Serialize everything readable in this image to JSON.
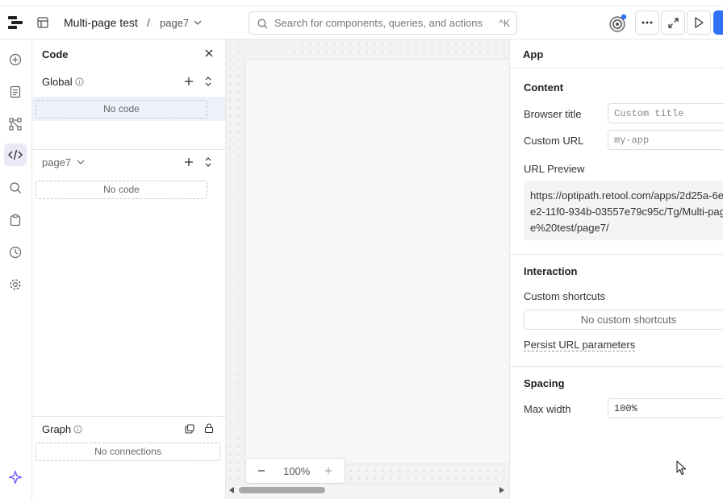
{
  "header": {
    "app_name": "Multi-page test",
    "separator": "/",
    "page_name": "page7",
    "search": {
      "placeholder": "Search for components, queries, and actions",
      "shortcut": "^K"
    }
  },
  "left_rail": {
    "icons": [
      "add-icon",
      "pages-icon",
      "components-tree-icon",
      "code-icon",
      "search-icon",
      "state-icon",
      "history-icon",
      "settings-icon",
      "assist-sparkle-icon"
    ],
    "active": "code-icon"
  },
  "code_panel": {
    "title": "Code",
    "global": {
      "label": "Global",
      "empty": "No code"
    },
    "page": {
      "label": "page7",
      "empty": "No code"
    },
    "graph": {
      "label": "Graph",
      "empty": "No connections"
    }
  },
  "canvas": {
    "zoom": "100%"
  },
  "inspector": {
    "title": "App",
    "content": {
      "heading": "Content",
      "browser_title": {
        "label": "Browser title",
        "placeholder": "Custom title"
      },
      "custom_url": {
        "label": "Custom URL",
        "placeholder": "my-app"
      },
      "url_preview": {
        "label": "URL Preview",
        "value": "https://optipath.retool.com/apps/2d25a-6ee2-11f0-934b-03557e79c95c/Tg/Multi-page%20test/page7/"
      }
    },
    "interaction": {
      "heading": "Interaction",
      "custom_shortcuts": {
        "label": "Custom shortcuts",
        "empty": "No custom shortcuts"
      },
      "persist_url": "Persist URL parameters"
    },
    "spacing": {
      "heading": "Spacing",
      "max_width": {
        "label": "Max width",
        "value": "100%"
      }
    }
  },
  "colors": {
    "accent": "#3170f9",
    "active_rail": "#e9eaf6",
    "assist": "#7c5cf6"
  }
}
